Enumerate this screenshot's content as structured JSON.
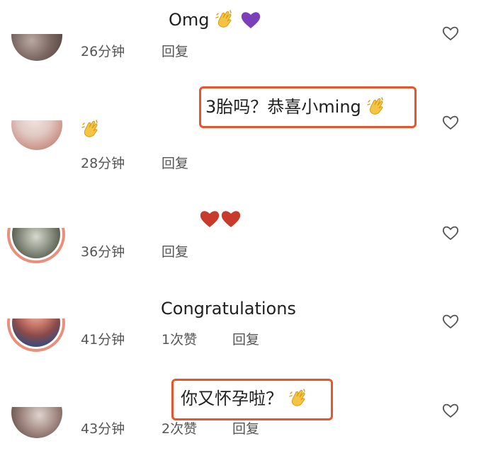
{
  "comments": [
    {
      "text": "Omg",
      "time": "26分钟",
      "reply": "回复"
    },
    {
      "text": "3胎吗？恭喜小ming",
      "time": "28分钟",
      "reply": "回复"
    },
    {
      "text": "",
      "time": "36分钟",
      "reply": "回复"
    },
    {
      "text": "Congratulations",
      "time": "41分钟",
      "likes": "1次赞",
      "reply": "回复"
    },
    {
      "text": "你又怀孕啦？",
      "time": "43分钟",
      "likes": "2次赞",
      "reply": "回复"
    }
  ],
  "icons": {
    "like": "heart-outline-icon",
    "clap": "clapping-hands-emoji",
    "purple_heart": "purple-heart-emoji",
    "red_heart": "red-heart-emoji"
  },
  "colors": {
    "highlight": "#e8542b",
    "story_ring": "#e8907a",
    "meta_text": "#555555"
  }
}
